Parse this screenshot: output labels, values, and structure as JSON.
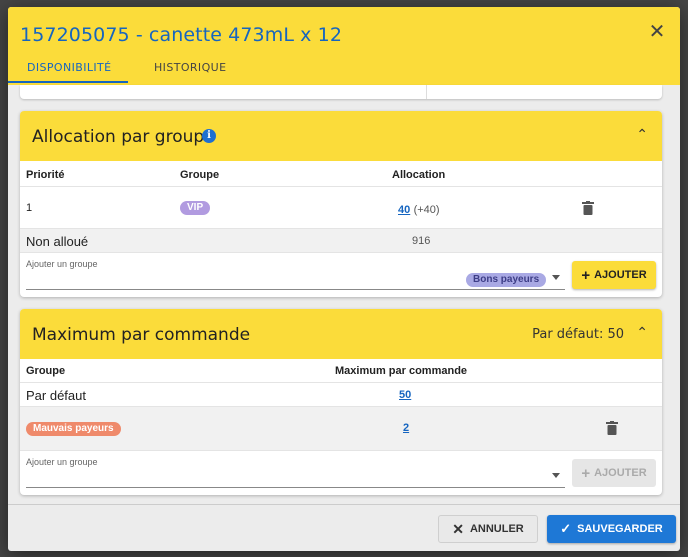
{
  "dialog": {
    "title": "157205075 - canette 473mL x 12",
    "close_icon": "close-icon",
    "tabs": [
      {
        "label": "DISPONIBILITÉ",
        "active": true
      },
      {
        "label": "HISTORIQUE",
        "active": false
      }
    ]
  },
  "allocation": {
    "title": "Allocation par groupe",
    "info_icon": "i",
    "headers": {
      "priority": "Priorité",
      "group": "Groupe",
      "allocation": "Allocation"
    },
    "rows": [
      {
        "priority": "1",
        "group": "VIP",
        "allocation": "40",
        "delta": "(+40)"
      }
    ],
    "unallocated_label": "Non alloué",
    "unallocated_value": "916",
    "add_label": "Ajouter un groupe",
    "selected_chip": "Bons payeurs",
    "add_button": "AJOUTER"
  },
  "max_per_order": {
    "title": "Maximum par commande",
    "default_label": "Par défaut: 50",
    "headers": {
      "group": "Groupe",
      "max": "Maximum par commande"
    },
    "rows": [
      {
        "group": "Par défaut",
        "max": "50"
      },
      {
        "group": "Mauvais payeurs",
        "max": "2"
      }
    ],
    "add_label": "Ajouter un groupe",
    "add_button": "AJOUTER"
  },
  "footer": {
    "cancel": "ANNULER",
    "save": "SAUVEGARDER"
  },
  "colors": {
    "accent_yellow": "#fbdc3a",
    "primary_blue": "#1e78d6",
    "vip_chip": "#b19be0",
    "bons_chip": "#a9a9e4",
    "mauvais_chip": "#ef8a6b"
  }
}
